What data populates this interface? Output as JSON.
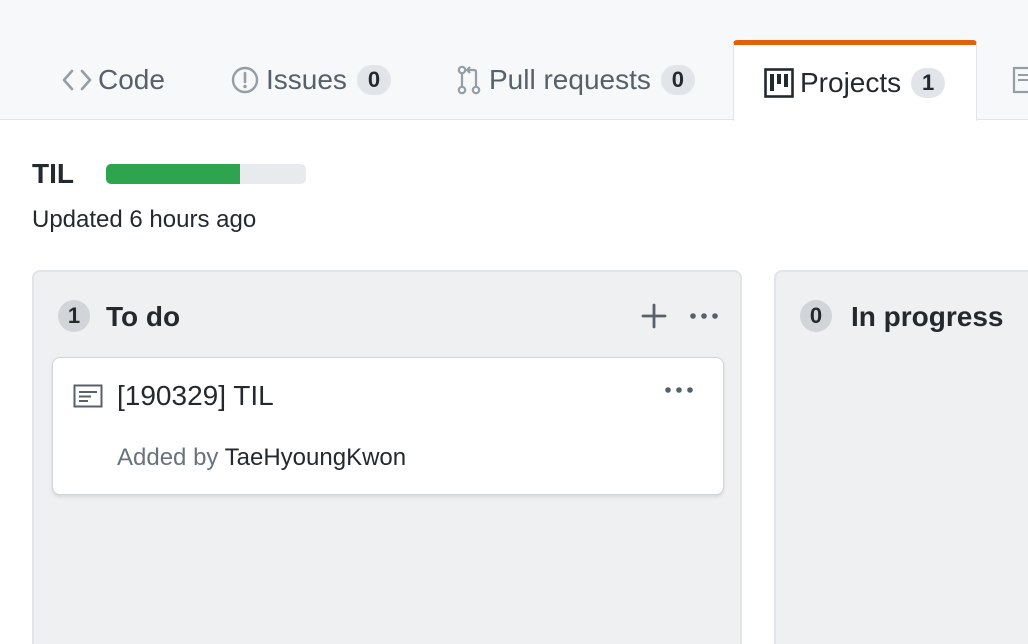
{
  "tabs": {
    "code": {
      "label": "Code",
      "icon": "code-icon"
    },
    "issues": {
      "label": "Issues",
      "count": "0",
      "icon": "issue-icon"
    },
    "pulls": {
      "label": "Pull requests",
      "count": "0",
      "icon": "pull-request-icon"
    },
    "projects": {
      "label": "Projects",
      "count": "1",
      "icon": "project-icon",
      "selected": true,
      "accent": "#e36209"
    }
  },
  "project": {
    "title": "TIL",
    "progress_fraction": 0.67,
    "progress_color": "#2ea44f",
    "updated": "Updated 6 hours ago"
  },
  "columns": [
    {
      "count": "1",
      "name": "To do",
      "cards": [
        {
          "title": "[190329] TIL",
          "icon": "note-icon",
          "added_by_prefix": "Added by",
          "author": "TaeHyoungKwon"
        }
      ]
    },
    {
      "count": "0",
      "name": "In progress",
      "cards": []
    }
  ]
}
